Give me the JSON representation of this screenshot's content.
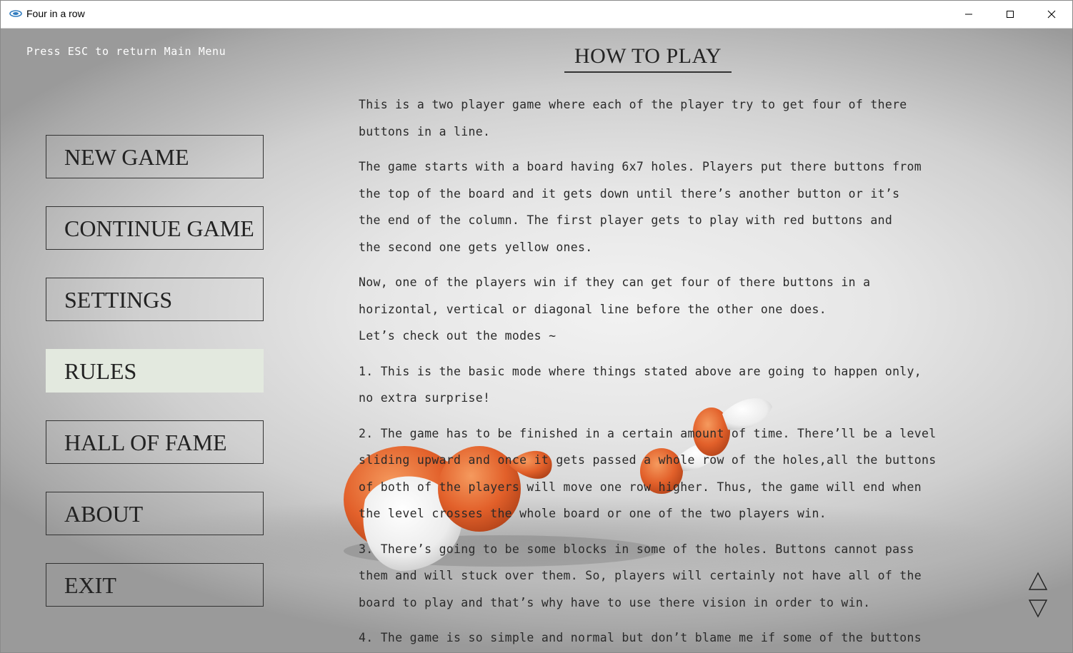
{
  "window": {
    "title": "Four in a row"
  },
  "header": {
    "esc_hint": "Press ESC to return Main Menu",
    "page_title": "HOW TO PLAY"
  },
  "menu": {
    "items": [
      {
        "label": "NEW GAME"
      },
      {
        "label": "CONTINUE GAME"
      },
      {
        "label": "SETTINGS"
      },
      {
        "label": "RULES"
      },
      {
        "label": "HALL OF FAME"
      },
      {
        "label": "ABOUT"
      },
      {
        "label": "EXIT"
      }
    ],
    "active": "RULES"
  },
  "rules": {
    "paragraphs": [
      "This is a two player game where each of the player try to get four of there\nbuttons in a line.",
      "The game starts with a board having 6x7 holes. Players put there buttons from\nthe top of the board and it gets down until there’s another button or it’s\nthe end of the column. The first player gets to play with red buttons and\nthe second one gets yellow ones.",
      "Now, one of the players win if they can get four of there buttons in a\nhorizontal, vertical or diagonal line before the other one does.\nLet’s check out the modes ~",
      "1. This is the basic mode where things stated above are going to happen only,\nno extra surprise!",
      "2. The game has to be finished in a certain amount of time. There’ll be a level\nsliding upward and once it gets passed a whole row of the holes,all the buttons\nof both of the players will move one row higher. Thus, the game will end when\nthe level crosses the whole board or one of the two players win.",
      "3. There’s going to be some blocks in some of the holes. Buttons cannot pass\nthem and will stuck over them. So, players will certainly not have all of the\nboard to play and that’s why have to use there vision in order to win.",
      "4. The game is so simple and normal but don’t blame me if some of the buttons"
    ]
  },
  "icons": {
    "scroll_up": "triangle-up-icon",
    "scroll_down": "triangle-down-icon",
    "minimize": "minimize-icon",
    "maximize": "maximize-icon",
    "close": "close-icon",
    "app": "app-icon"
  },
  "colors": {
    "active_menu_bg": "#e3e9df",
    "accent_orange": "#e8632a",
    "text": "#2a2a2a"
  }
}
